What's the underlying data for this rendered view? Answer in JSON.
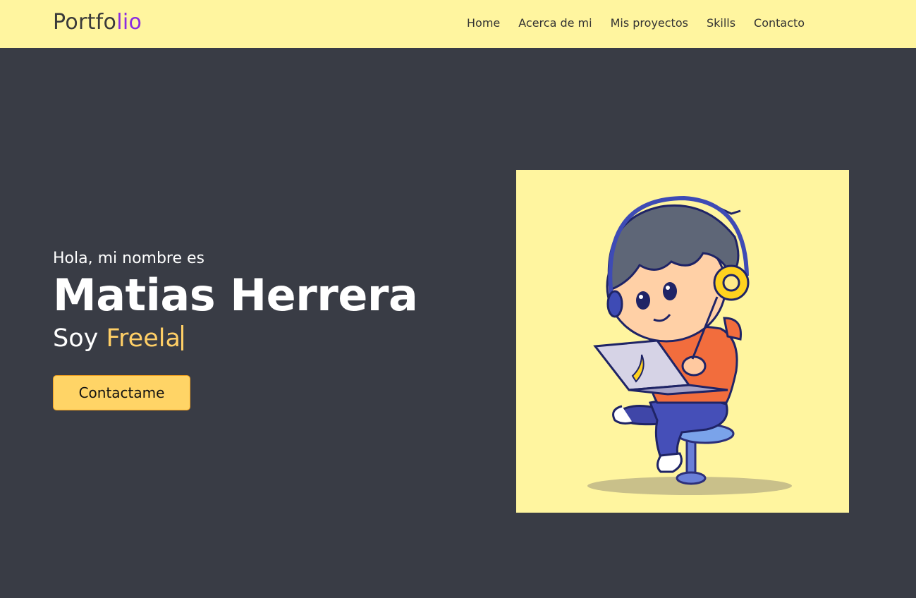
{
  "header": {
    "logo_main": "Portfo",
    "logo_accent": "lio",
    "nav": [
      {
        "label": "Home"
      },
      {
        "label": "Acerca de mi"
      },
      {
        "label": "Mis proyectos"
      },
      {
        "label": "Skills"
      },
      {
        "label": "Contacto"
      }
    ]
  },
  "hero": {
    "greeting": "Hola, mi nombre es",
    "name": "Matias Herrera",
    "role_prefix": "Soy ",
    "role_typed": "Freela",
    "cta_label": "Contactame"
  },
  "colors": {
    "navbar_bg": "#fff59f",
    "page_bg": "#393c45",
    "logo_accent": "#8a2be2",
    "highlight": "#ffcf66",
    "button_bg": "#ffd466"
  },
  "icons": {
    "illustration": "boy-with-headphones-and-laptop"
  }
}
